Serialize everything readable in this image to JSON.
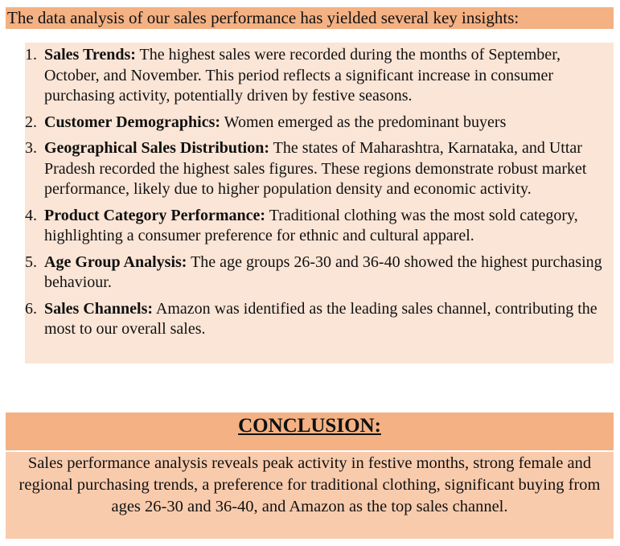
{
  "intro": {
    "text": "The data analysis of our sales performance has yielded several key insights:",
    "background": "#f4b183"
  },
  "insights": {
    "background": "#fbe5d6",
    "items": [
      {
        "number": "1.",
        "label": "Sales Trends:",
        "text": " The highest sales were recorded during the months of September, October, and November. This period reflects a significant increase in consumer purchasing activity, potentially driven by festive seasons."
      },
      {
        "number": "2.",
        "label": "Customer Demographics:",
        "text": " Women emerged as the predominant buyers"
      },
      {
        "number": "3.",
        "label": "Geographical Sales Distribution:",
        "text": " The states of Maharashtra, Karnataka, and Uttar Pradesh recorded the highest sales figures. These regions demonstrate robust market performance, likely due to higher population density and economic activity."
      },
      {
        "number": "4.",
        "label": "Product Category Performance:",
        "text": " Traditional clothing was the most sold category, highlighting a consumer preference for ethnic and cultural apparel."
      },
      {
        "number": "5.",
        "label": "Age Group Analysis:",
        "text": " The age groups 26-30 and 36-40 showed the highest purchasing behaviour."
      },
      {
        "number": "6.",
        "label": "Sales Channels:",
        "text": " Amazon was identified as the leading sales channel, contributing the most to our overall sales."
      }
    ]
  },
  "conclusion": {
    "heading": "CONCLUSION:",
    "heading_background": "#f4b183",
    "body": "Sales performance analysis reveals peak activity in festive months, strong female and regional purchasing trends, a preference for traditional clothing, significant buying from ages 26-30 and 36-40, and Amazon as the top sales channel.",
    "body_background": "#f8cbad"
  }
}
